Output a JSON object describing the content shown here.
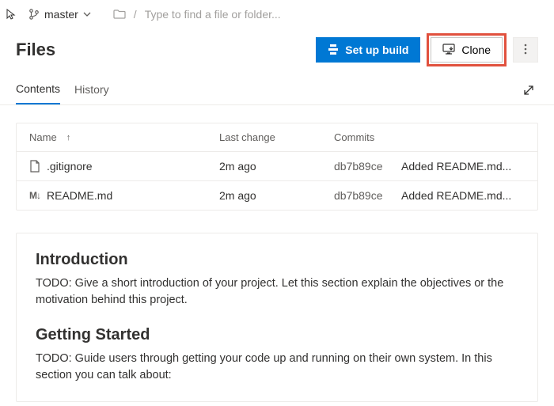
{
  "breadcrumb": {
    "branch": "master",
    "search_placeholder": "Type to find a file or folder..."
  },
  "header": {
    "title": "Files",
    "setup_build_label": "Set up build",
    "clone_label": "Clone"
  },
  "tabs": {
    "contents": "Contents",
    "history": "History"
  },
  "table": {
    "headers": {
      "name": "Name",
      "last_change": "Last change",
      "commits": "Commits"
    },
    "rows": [
      {
        "name": ".gitignore",
        "type": "file",
        "last_change": "2m ago",
        "commit": "db7b89ce",
        "message": "Added README.md..."
      },
      {
        "name": "README.md",
        "type": "md",
        "last_change": "2m ago",
        "commit": "db7b89ce",
        "message": "Added README.md..."
      }
    ]
  },
  "readme": {
    "h1": "Introduction",
    "p1": "TODO: Give a short introduction of your project. Let this section explain the objectives or the motivation behind this project.",
    "h2": "Getting Started",
    "p2": "TODO: Guide users through getting your code up and running on their own system. In this section you can talk about:"
  }
}
